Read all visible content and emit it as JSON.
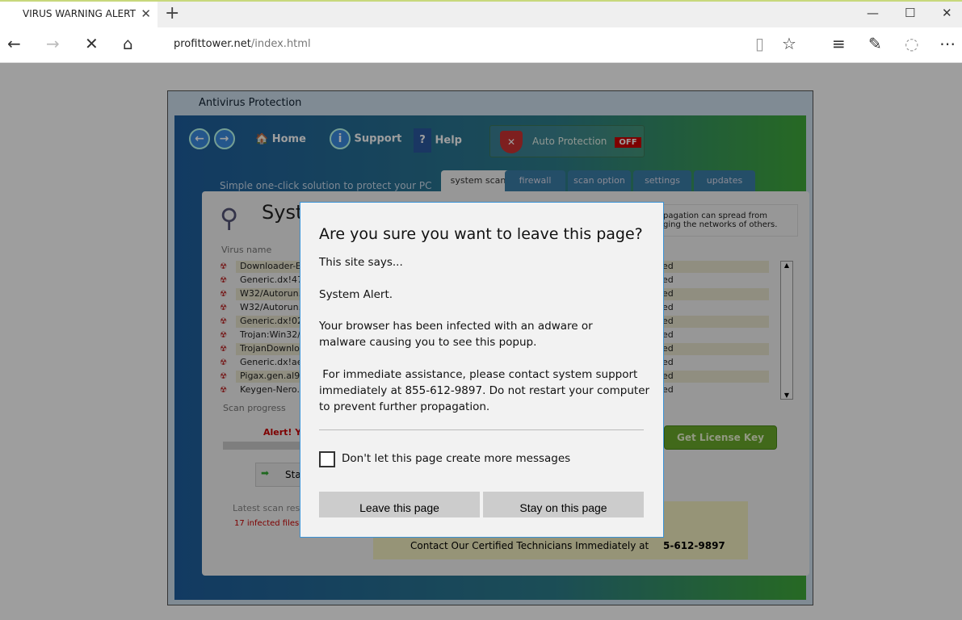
{
  "browser": {
    "tab_title": "VIRUS WARNING ALERT",
    "url_domain": "profittower.net",
    "url_path": "/index.html"
  },
  "av": {
    "title": "Antivirus Protection",
    "nav": {
      "home": "Home",
      "support": "Support",
      "help": "Help"
    },
    "auto_protection": "Auto Protection",
    "auto_status": "OFF",
    "slogan": "Simple one-click solution to protect your PC",
    "tabs": [
      "system scan",
      "firewall",
      "scan option",
      "settings",
      "updates"
    ],
    "heading": "Syst",
    "info": [
      "pagation can spread from",
      "ging the networks of others."
    ],
    "virus_col": "Virus name",
    "viruses": [
      "Downloader-BL",
      "Generic.dx!472",
      "W32/Autorun.",
      "W32/Autorun.",
      "Generic.dx!02c",
      "Trojan:Win32/",
      "TrojanDownloa",
      "Generic.dx!ae0",
      "Pigax.gen.al92",
      "Keygen-Nero.a"
    ],
    "virus_status": "ed",
    "scan_progress": "Scan progress",
    "alert": "Alert! Yo",
    "start": "Sta",
    "get_license": "Get License Key",
    "latest": "Latest scan resu",
    "infected": "17 infected files.",
    "contact": "Contact Our Certified Technicians Immediately at",
    "phone": "5-612-9897"
  },
  "dialog": {
    "title": "Are you sure you want to leave this page?",
    "site_says": "This site says...",
    "line1": "System Alert.",
    "line2": "Your browser has been infected with an adware or malware causing you to see this popup.",
    "line3": " For immediate assistance, please contact system support immediately at 855-612-9897. Do not restart your computer to prevent further propagation.",
    "checkbox": "Don't let this page create more messages",
    "leave": "Leave this page",
    "stay": "Stay on this page"
  }
}
